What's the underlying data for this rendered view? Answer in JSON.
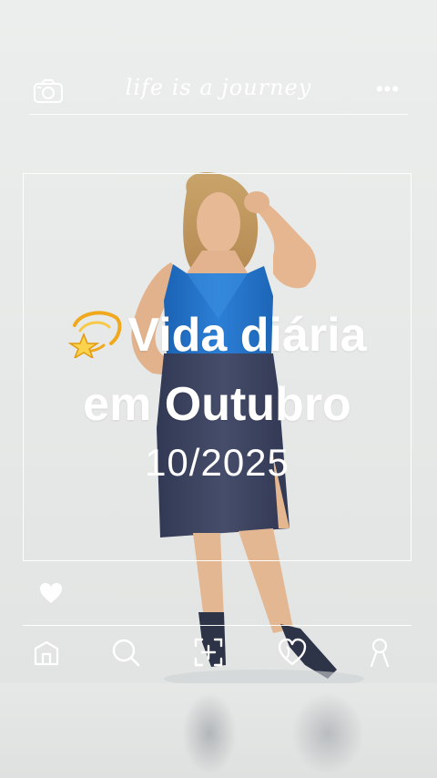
{
  "header": {
    "tagline": "life is a journey",
    "camera_icon": "camera-icon",
    "more_icon": "more-dots-icon",
    "more_glyph": "•••"
  },
  "post": {
    "title_line1": "Vida diária",
    "title_line2": "em Outubro",
    "date": "10/2025",
    "emoji_icon": "dizzy-star-icon"
  },
  "actions": {
    "like_icon": "heart-icon"
  },
  "nav": {
    "items": [
      {
        "icon": "home-icon"
      },
      {
        "icon": "search-icon"
      },
      {
        "icon": "add-post-icon"
      },
      {
        "icon": "heart-outline-icon"
      },
      {
        "icon": "profile-icon"
      }
    ]
  },
  "colors": {
    "overlay_text": "#ffffff",
    "background": "#e9ebea",
    "top_blue": "#1f6fc2",
    "skirt": "#3d4460"
  }
}
